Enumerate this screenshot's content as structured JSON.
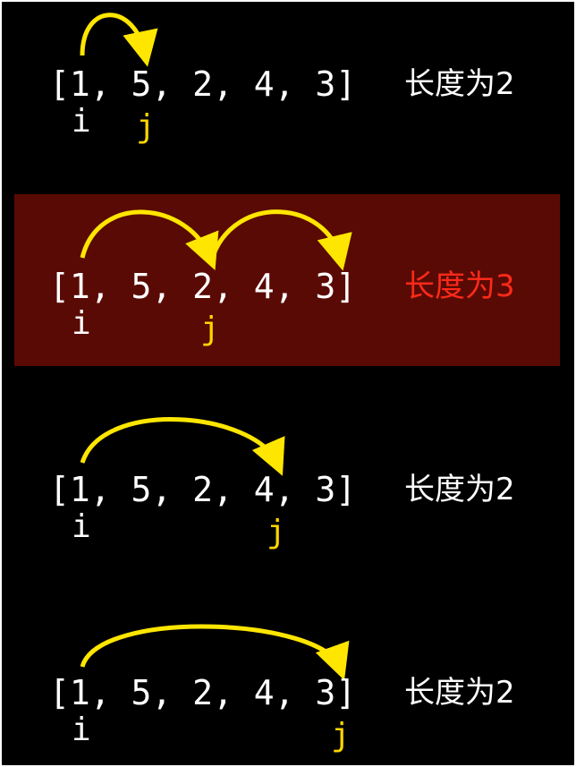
{
  "colors": {
    "background": "#000000",
    "text": "#ffffff",
    "arrow": "#ffe600",
    "pointer_j": "#ffd600",
    "highlight_bg": "#5a0a04",
    "highlight_text": "#ff2a1a"
  },
  "steps": [
    {
      "array": "[1, 5, 2, 4, 3]",
      "pointer_i": "i",
      "pointer_j": "j",
      "length_label": "长度为2",
      "highlighted": false
    },
    {
      "array": "[1, 5, 2, 4, 3]",
      "pointer_i": "i",
      "pointer_j": "j",
      "length_label": "长度为3",
      "highlighted": true
    },
    {
      "array": "[1, 5, 2, 4, 3]",
      "pointer_i": "i",
      "pointer_j": "j",
      "length_label": "长度为2",
      "highlighted": false
    },
    {
      "array": "[1, 5, 2, 4, 3]",
      "pointer_i": "i",
      "pointer_j": "j",
      "length_label": "长度为2",
      "highlighted": false
    }
  ]
}
